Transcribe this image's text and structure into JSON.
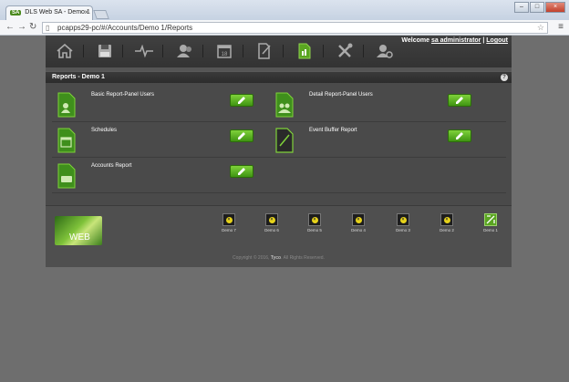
{
  "browser": {
    "tab_title": "DLS Web SA - Demo 1",
    "tab_badge": "SA",
    "url": "pcapps29-pc/#/Accounts/Demo 1/Reports"
  },
  "nav": {
    "welcome_prefix": "Welcome",
    "user": "sa administrator",
    "separator": "|",
    "logout": "Logout",
    "icons": [
      "home-icon",
      "save-icon",
      "activity-icon",
      "users-icon",
      "calendar-icon",
      "edit-document-icon",
      "reports-icon",
      "tools-icon",
      "user-settings-icon"
    ]
  },
  "reports": {
    "heading": "Reports - Demo 1",
    "help": "?",
    "items": [
      {
        "label": "Basic Report-Panel Users"
      },
      {
        "label": "Detail Report-Panel Users"
      },
      {
        "label": "Schedules"
      },
      {
        "label": "Event Buffer Report"
      },
      {
        "label": "Accounts Report"
      }
    ]
  },
  "footer": {
    "logo_text": "WEB",
    "devices": [
      {
        "label": "Demo 7",
        "active": false
      },
      {
        "label": "Demo 6",
        "active": false
      },
      {
        "label": "Demo 5",
        "active": false
      },
      {
        "label": "Demo 4",
        "active": false
      },
      {
        "label": "Demo 3",
        "active": false
      },
      {
        "label": "Demo 2",
        "active": false
      },
      {
        "label": "Demo 1",
        "active": true
      }
    ],
    "copyright_prefix": "Copyright © 2016,",
    "copyright_brand": "Tyco",
    "copyright_suffix": ". All Rights Reserved."
  },
  "colors": {
    "accent": "#5aa521",
    "panel": "#4a4a4a",
    "nav": "#3a3a3a"
  }
}
